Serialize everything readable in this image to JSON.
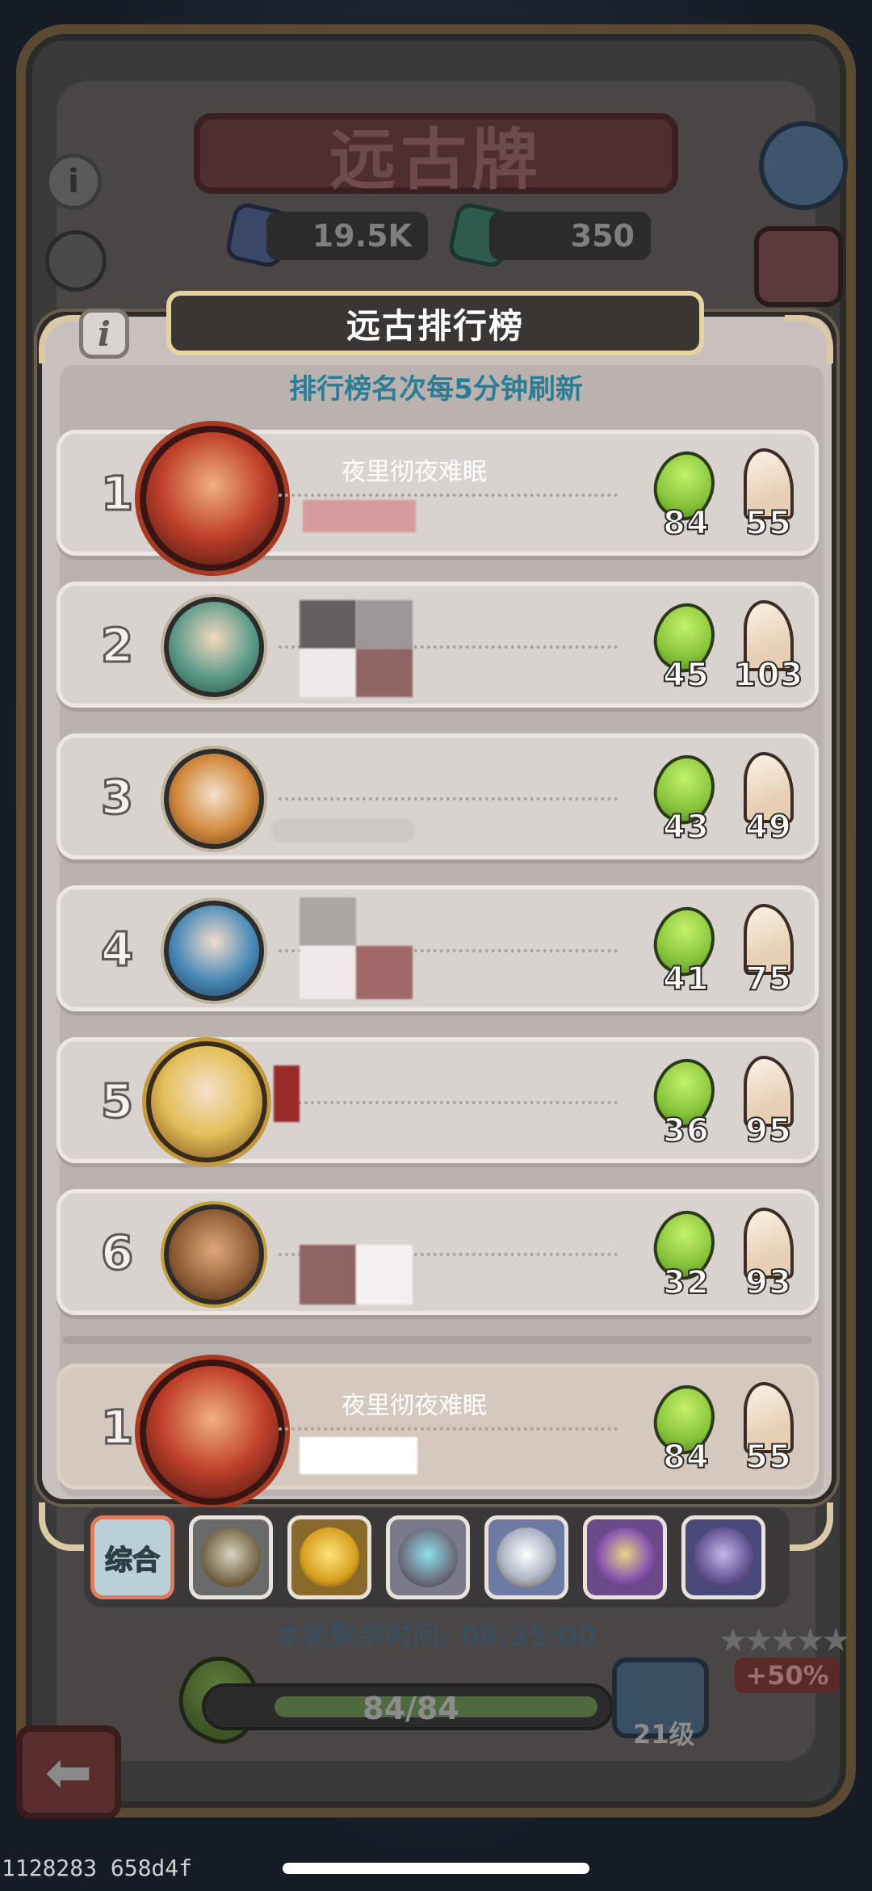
{
  "background": {
    "title": "远古牌",
    "currency_1": "19.5K",
    "currency_2": "350",
    "colors": {
      "gem_blue": "#3a4766",
      "gem_green": "#2f5a4e"
    }
  },
  "modal": {
    "header": "远古排行榜",
    "subtitle": "排行榜名次每5分钟刷新",
    "info_icon": "i"
  },
  "rows": [
    {
      "rank": "1",
      "name": "夜里彻夜难眠",
      "bean": "84",
      "horse": "55",
      "avatar_color": "#b8342a",
      "avatar_icon": "red-dragon-avatar"
    },
    {
      "rank": "2",
      "name": "",
      "bean": "45",
      "horse": "103",
      "avatar_color": "#5d9c8a",
      "avatar_icon": "elf-avatar"
    },
    {
      "rank": "3",
      "name": "",
      "bean": "43",
      "horse": "49",
      "avatar_color": "#d38a3e",
      "avatar_icon": "tiger-avatar"
    },
    {
      "rank": "4",
      "name": "",
      "bean": "41",
      "horse": "75",
      "avatar_color": "#4a8ab8",
      "avatar_icon": "blue-elf-avatar"
    },
    {
      "rank": "5",
      "name": "",
      "bean": "36",
      "horse": "95",
      "avatar_color": "#e3c05a",
      "avatar_icon": "blonde-hero-avatar"
    },
    {
      "rank": "6",
      "name": "",
      "bean": "32",
      "horse": "93",
      "avatar_color": "#8c5a34",
      "avatar_icon": "pilot-avatar"
    }
  ],
  "my_row": {
    "rank": "1",
    "name": "夜里彻夜难眠",
    "bean": "84",
    "horse": "55"
  },
  "tabs": {
    "active_label": "综合",
    "items": [
      "armored-hero-icon",
      "golden-creature-icon",
      "mech-hero-icon",
      "eagle-hero-icon",
      "purple-sorceress-icon",
      "dark-beast-icon"
    ]
  },
  "timer": "本轮剩余时间: 08:35:00",
  "progress": {
    "text": "84/84",
    "fraction": 1.0
  },
  "level": "21级",
  "bonus": "+50%",
  "build_id": "1128283 658d4f"
}
